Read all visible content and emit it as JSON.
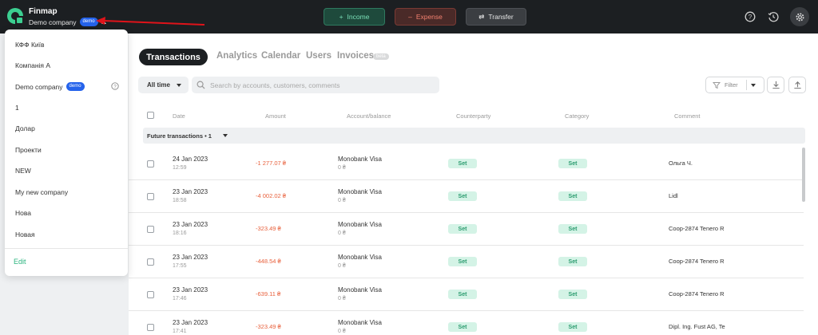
{
  "app": {
    "name": "Finmap",
    "company": "Demo company",
    "badge": "demo"
  },
  "actions": {
    "income": "Income",
    "expense": "Expense",
    "transfer": "Transfer"
  },
  "dropdown": {
    "items": [
      {
        "label": "КФФ Київ"
      },
      {
        "label": "Компанія А"
      },
      {
        "label": "Demo company",
        "badge": "demo"
      },
      {
        "label": "1"
      },
      {
        "label": "Долар"
      },
      {
        "label": "Проекти"
      },
      {
        "label": "NEW"
      },
      {
        "label": "My new company"
      },
      {
        "label": "Нова"
      },
      {
        "label": "Новая"
      }
    ],
    "edit": "Edit"
  },
  "tabs": [
    {
      "label": "Transactions",
      "active": true
    },
    {
      "label": "Analytics"
    },
    {
      "label": "Calendar"
    },
    {
      "label": "Users"
    },
    {
      "label": "Invoices",
      "badge": "beta"
    }
  ],
  "filters": {
    "period": "All time",
    "search_placeholder": "Search by accounts, customers, comments",
    "filter_label": "Filter"
  },
  "table": {
    "headers": [
      "Date",
      "Amount",
      "Account/balance",
      "Counterparty",
      "Category",
      "Comment"
    ],
    "future_label": "Future transactions • 1",
    "rows": [
      {
        "date": "24 Jan 2023",
        "time": "12:59",
        "amount": "-1 277.07 ₴",
        "account": "Monobank Visa",
        "balance": "0 ₴",
        "counterparty": "Set",
        "category": "Set",
        "comment": "Ольга Ч."
      },
      {
        "date": "23 Jan 2023",
        "time": "18:58",
        "amount": "-4 002.02 ₴",
        "account": "Monobank Visa",
        "balance": "0 ₴",
        "counterparty": "Set",
        "category": "Set",
        "comment": "Lidl"
      },
      {
        "date": "23 Jan 2023",
        "time": "18:16",
        "amount": "-323.49 ₴",
        "account": "Monobank Visa",
        "balance": "0 ₴",
        "counterparty": "Set",
        "category": "Set",
        "comment": "Coop-2874 Tenero R"
      },
      {
        "date": "23 Jan 2023",
        "time": "17:55",
        "amount": "-448.54 ₴",
        "account": "Monobank Visa",
        "balance": "0 ₴",
        "counterparty": "Set",
        "category": "Set",
        "comment": "Coop-2874 Tenero R"
      },
      {
        "date": "23 Jan 2023",
        "time": "17:46",
        "amount": "-639.11 ₴",
        "account": "Monobank Visa",
        "balance": "0 ₴",
        "counterparty": "Set",
        "category": "Set",
        "comment": "Coop-2874 Tenero R"
      },
      {
        "date": "23 Jan 2023",
        "time": "17:41",
        "amount": "-323.49 ₴",
        "account": "Monobank Visa",
        "balance": "0 ₴",
        "counterparty": "Set",
        "category": "Set",
        "comment": "Dipl. Ing. Fust AG, Te"
      }
    ]
  },
  "colors": {
    "accent": "#2bb57f",
    "topbar": "#1c1f22",
    "negative": "#e8603c",
    "annotation_arrow": "#e0131a"
  }
}
